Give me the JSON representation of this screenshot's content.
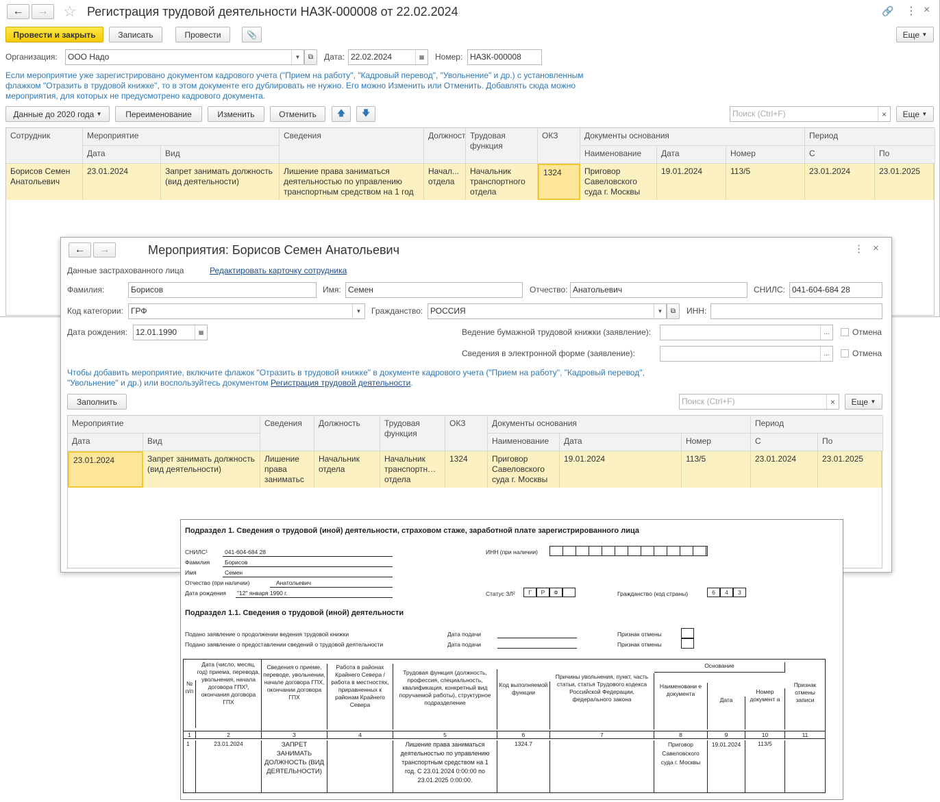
{
  "main": {
    "title": "Регистрация трудовой деятельности НАЗК-000008 от 22.02.2024",
    "toolbar": {
      "post_close": "Провести и закрыть",
      "save": "Записать",
      "post": "Провести",
      "more": "Еще"
    },
    "org_label": "Организация:",
    "org_value": "ООО Надо",
    "date_label": "Дата:",
    "date_value": "22.02.2024",
    "num_label": "Номер:",
    "num_value": "НАЗК-000008",
    "info": "Если мероприятие уже зарегистрировано документом кадрового учета (\"Прием на работу\", \"Кадровый перевод\", \"Увольнение\" и др.) с установленным флажком \"Отразить в трудовой книжке\", то в этом документе его дублировать не нужно. Его можно Изменить или Отменить. Добавлять сюда можно мероприятия, для которых не предусмотрено кадрового документа.",
    "table_toolbar": {
      "data_before": "Данные до 2020 года",
      "rename": "Переименование",
      "change": "Изменить",
      "cancel": "Отменить",
      "search_placeholder": "Поиск (Ctrl+F)",
      "more": "Еще"
    },
    "columns": {
      "employee": "Сотрудник",
      "event": "Мероприятие",
      "date": "Дата",
      "kind": "Вид",
      "info": "Сведения",
      "position": "Должность",
      "function": "Трудовая функция",
      "okz": "ОКЗ",
      "docs": "Документы основания",
      "doc_name": "Наименование",
      "doc_date": "Дата",
      "doc_num": "Номер",
      "period": "Период",
      "from": "С",
      "to": "По"
    },
    "row": {
      "employee": "Борисов Семен Анатольевич",
      "date": "23.01.2024",
      "kind": "Запрет занимать должность (вид деятельности)",
      "info": "Лишение права заниматься деятельностью по управлению транспортным средством на 1 год",
      "position": "Начал... отдела",
      "function": "Начальник транспортного отдела",
      "okz": "1324",
      "doc_name": "Приговор Савеловского суда г. Москвы",
      "doc_date": "19.01.2024",
      "doc_num": "113/5",
      "from": "23.01.2024",
      "to": "23.01.2025"
    }
  },
  "dialog": {
    "title": "Мероприятия: Борисов Семен Анатольевич",
    "section_label": "Данные застрахованного лица",
    "edit_link": "Редактировать карточку сотрудника",
    "surname_label": "Фамилия:",
    "surname": "Борисов",
    "name_label": "Имя:",
    "name": "Семен",
    "patronymic_label": "Отчество:",
    "patronymic": "Анатольевич",
    "snils_label": "СНИЛС:",
    "snils": "041-604-684 28",
    "category_label": "Код категории:",
    "category": "ГРФ",
    "citizenship_label": "Гражданство:",
    "citizenship": "РОССИЯ",
    "inn_label": "ИНН:",
    "inn": "",
    "birth_label": "Дата рождения:",
    "birth": "12.01.1990",
    "paper_label": "Ведение бумажной трудовой книжки (заявление):",
    "electronic_label": "Сведения в электронной форме (заявление):",
    "cancel_label": "Отмена",
    "info_1": "Чтобы добавить мероприятие, включите флажок \"Отразить в трудовой книжке\" в документе кадрового учета (\"Прием на работу\", \"Кадровый перевод\",",
    "info_2": "\"Увольнение\" и др.) или воспользуйтесь документом ",
    "info_link": "Регистрация трудовой деятельности",
    "fill": "Заполнить",
    "search_placeholder": "Поиск (Ctrl+F)",
    "more": "Еще",
    "columns": {
      "event": "Мероприятие",
      "date": "Дата",
      "kind": "Вид",
      "info": "Сведения",
      "position": "Должность",
      "function": "Трудовая функция",
      "okz": "ОКЗ",
      "docs": "Документы основания",
      "doc_name": "Наименование",
      "doc_date": "Дата",
      "doc_num": "Номер",
      "period": "Период",
      "from": "С",
      "to": "По"
    },
    "row": {
      "date": "23.01.2024",
      "kind": "Запрет занимать должность (вид деятельности)",
      "info": "Лишение права заниматьс",
      "position": "Начальник отдела",
      "function": "Начальник транспортн… отдела",
      "okz": "1324",
      "doc_name": "Приговор Савеловского суда г. Москвы",
      "doc_date": "19.01.2024",
      "doc_num": "113/5",
      "from": "23.01.2024",
      "to": "23.01.2025"
    }
  },
  "report": {
    "heading": "Подраздел 1. Сведения о трудовой (иной) деятельности, страховом стаже, заработной плате зарегистрированного лица",
    "snils_label": "СНИЛС¹",
    "snils": "041-604-684 28",
    "inn_label": "ИНН (при наличии)",
    "surname_label": "Фамилия",
    "surname": "Борисов",
    "name_label": "Имя",
    "name": "Семен",
    "patronymic_label": "Отчество (при наличии)",
    "patronymic": "Анатольевич",
    "birth_label": "Дата рождения",
    "birth": "\"12\" января 1990 г.",
    "status_label": "Статус ЗЛ²",
    "status": [
      "Г",
      "Р",
      "Ф"
    ],
    "citizenship_label": "Гражданство (код страны)",
    "citizenship": [
      "6",
      "4",
      "3"
    ],
    "subheading": "Подраздел 1.1. Сведения о трудовой (иной) деятельности",
    "stmt1": "Подано заявление о продолжении ведения трудовой книжки",
    "stmt2": "Подано заявление о предоставлении сведений о трудовой деятельности",
    "submit_date": "Дата подачи",
    "cancel_sign": "Признак отмены",
    "th": {
      "c1": "№ п/п",
      "c2": "Дата (число, месяц, год) приема, перевода, увольнения, начала договора ГПХ³, окончания договора ГПХ",
      "c3": "Сведения о приеме, переводе, увольнении, начале договора ГПХ, окончании договора ГПХ",
      "c4": "Работа в районах Крайнего Севера / работа в местностях, приравненных к районам Крайнего Севера",
      "c5": "Трудовая функция (должность, профессия, специальность, квалификация, конкретный вид поручаемой работы), структурное подразделение",
      "c6": "Код выполняемой функции",
      "c7": "Причины увольнения, пункт, часть статьи, статья Трудового кодекса Российской Федерации, федерального закона",
      "basis": "Основание",
      "c8": "Наименовани е документа",
      "c9": "Дата",
      "c10": "Номер документ а",
      "c11": "Признак отмены записи"
    },
    "nums": [
      "1",
      "2",
      "3",
      "4",
      "5",
      "6",
      "7",
      "8",
      "9",
      "10",
      "11"
    ],
    "row": {
      "c1": "1",
      "c2": "23.01.2024",
      "c3": "ЗАПРЕТ ЗАНИМАТЬ ДОЛЖНОСТЬ (ВИД ДЕЯТЕЛЬНОСТИ)",
      "c4": "",
      "c5": "Лишение права заниматься деятельностью по управлению транспортным средством на 1 год. С 23.01.2024 0:00:00 по 23.01.2025 0:00:00.",
      "c6": "1324.7",
      "c7": "",
      "c8": "Приговор Савеловского суда г. Москвы",
      "c9": "19.01.2024",
      "c10": "113/5",
      "c11": ""
    }
  }
}
